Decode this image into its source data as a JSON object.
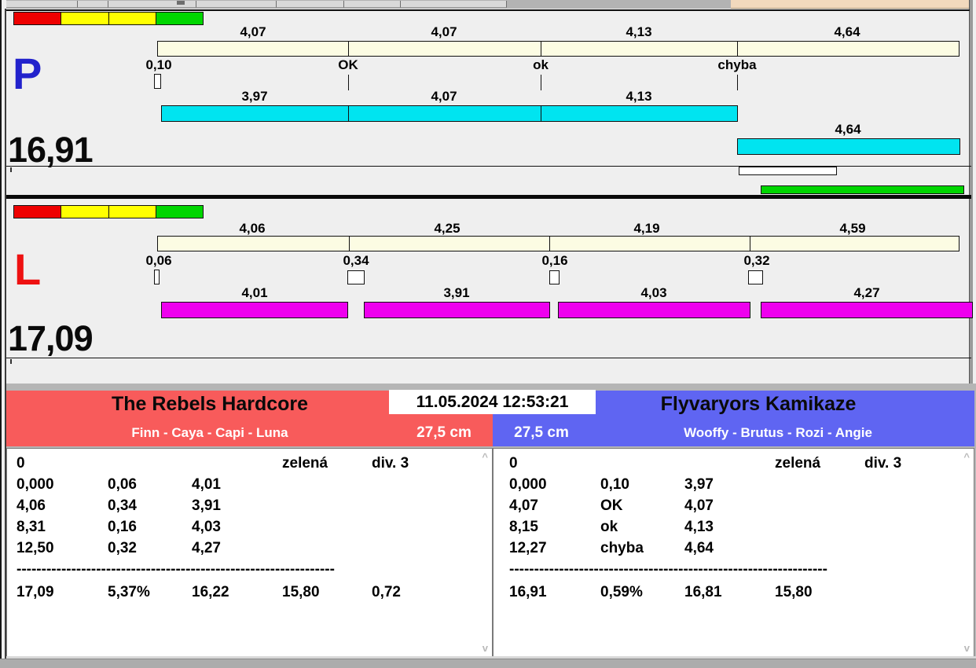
{
  "session": {
    "datetime": "11.05.2024 12:53:21"
  },
  "lane_p": {
    "id": "P",
    "total": "16,91",
    "ideal_segments": [
      "4,07",
      "4,07",
      "4,13",
      "4,64"
    ],
    "changeovers": [
      "0,10",
      "OK",
      "ok",
      "chyba"
    ],
    "run_segments": [
      "3,97",
      "4,07",
      "4,13"
    ],
    "final_segment": "4,64"
  },
  "lane_l": {
    "id": "L",
    "total": "17,09",
    "ideal_segments": [
      "4,06",
      "4,25",
      "4,19",
      "4,59"
    ],
    "changeovers": [
      "0,06",
      "0,34",
      "0,16",
      "0,32"
    ],
    "run_segments": [
      "4,01",
      "3,91",
      "4,03",
      "4,27"
    ]
  },
  "team_left": {
    "name": "The Rebels Hardcore",
    "dogs": "Finn - Caya - Capi - Luna",
    "jump_height": "27,5 cm",
    "log": {
      "start": "0",
      "light": "zelená",
      "division": "div. 3",
      "rows": [
        [
          "0,000",
          "0,06",
          "4,01"
        ],
        [
          "4,06",
          "0,34",
          "3,91"
        ],
        [
          "8,31",
          "0,16",
          "4,03"
        ],
        [
          "12,50",
          "0,32",
          "4,27"
        ]
      ],
      "separator": "----------------------------------------------------------------",
      "totals": [
        "17,09",
        "5,37%",
        "16,22",
        "15,80",
        "0,72"
      ]
    }
  },
  "team_right": {
    "name": "Flyvaryors Kamikaze",
    "dogs": "Wooffy - Brutus - Rozi - Angie",
    "jump_height": "27,5 cm",
    "log": {
      "start": "0",
      "light": "zelená",
      "division": "div. 3",
      "rows": [
        [
          "0,000",
          "0,10",
          "3,97"
        ],
        [
          "4,07",
          "OK",
          "4,07"
        ],
        [
          "8,15",
          "ok",
          "4,13"
        ],
        [
          "12,27",
          "chyba",
          "4,64"
        ]
      ],
      "separator": "----------------------------------------------------------------",
      "totals": [
        "16,91",
        "0,59%",
        "16,81",
        "15,80"
      ]
    }
  },
  "colors": {
    "lane_p_accent": "#2222cc",
    "lane_l_accent": "#ee1111",
    "lane_p_bar": "#00e4f0",
    "lane_l_bar": "#ee00ee",
    "ideal_bar": "#fcfce3",
    "team_left_bg": "#f85b5b",
    "team_right_bg": "#5f65f2",
    "marker_red": "#ee0000",
    "marker_yellow": "#ffff00",
    "marker_green": "#00d600",
    "progress_green": "#00d600",
    "topbar_beige": "#f2d9bd"
  }
}
